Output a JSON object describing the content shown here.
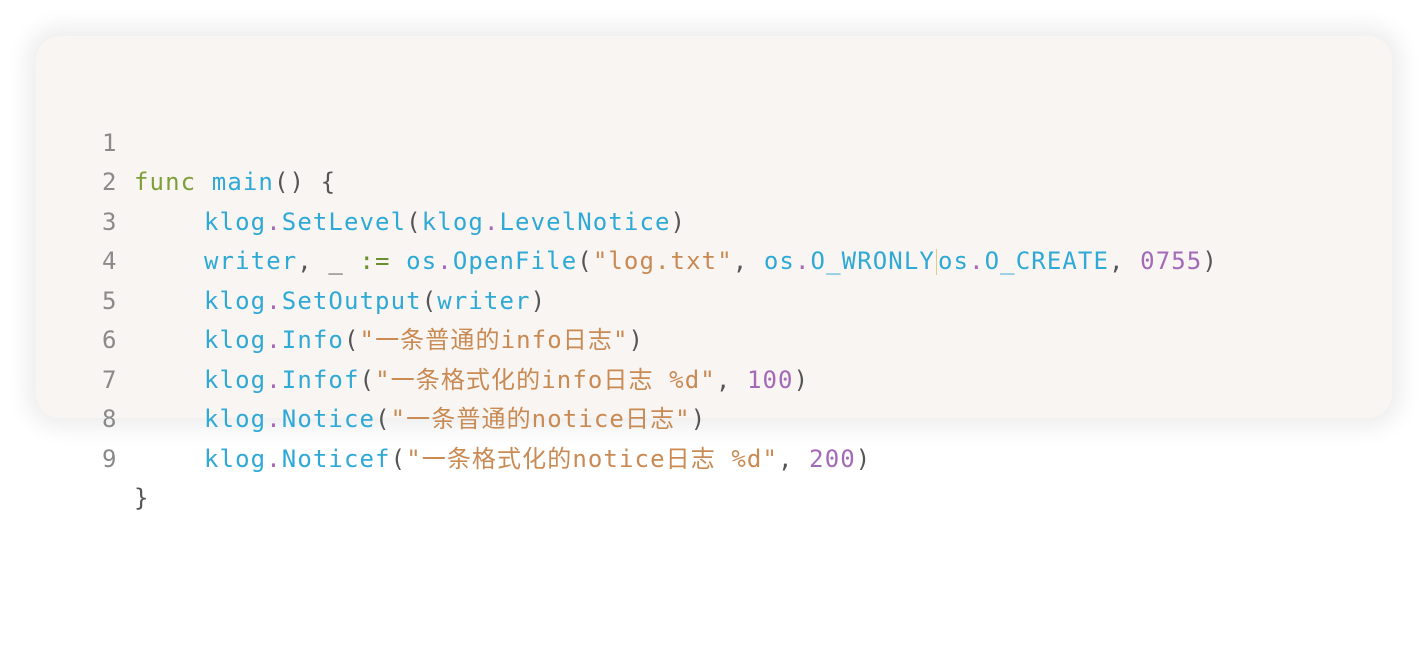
{
  "code": {
    "lines": [
      {
        "n": "1",
        "t": {
          "kw": "func",
          "sp": " ",
          "name": "main",
          "rest": "() {"
        }
      },
      {
        "n": "2"
      },
      {
        "n": "3"
      },
      {
        "n": "4"
      },
      {
        "n": "5"
      },
      {
        "n": "6"
      },
      {
        "n": "7"
      },
      {
        "n": "8"
      },
      {
        "n": "9"
      }
    ],
    "tokens": {
      "l2": [
        "klog",
        ".",
        "SetLevel",
        "(",
        "klog",
        ".",
        "LevelNotice",
        ")"
      ],
      "l3": [
        "writer",
        ", _ ",
        ":=",
        " ",
        "os",
        ".",
        "OpenFile",
        "(",
        "\"log.txt\"",
        ", ",
        "os",
        ".",
        "O_WRONLY",
        "|",
        "os",
        ".",
        "O_CREATE",
        ", ",
        "0755",
        ")"
      ],
      "l4": [
        "klog",
        ".",
        "SetOutput",
        "(",
        "writer",
        ")"
      ],
      "l5": [
        "klog",
        ".",
        "Info",
        "(",
        "\"一条普通的info日志\"",
        ")"
      ],
      "l6": [
        "klog",
        ".",
        "Infof",
        "(",
        "\"一条格式化的info日志 %d\"",
        ", ",
        "100",
        ")"
      ],
      "l7": [
        "klog",
        ".",
        "Notice",
        "(",
        "\"一条普通的notice日志\"",
        ")"
      ],
      "l8": [
        "klog",
        ".",
        "Noticef",
        "(",
        "\"一条格式化的notice日志 %d\"",
        ", ",
        "200",
        ")"
      ],
      "l9": [
        "}"
      ]
    }
  }
}
